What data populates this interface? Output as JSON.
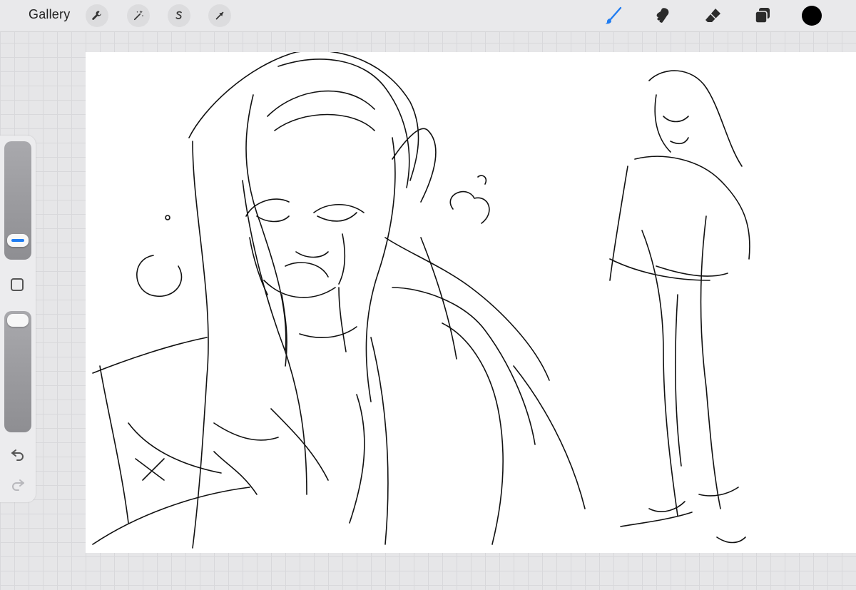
{
  "topbar": {
    "gallery_label": "Gallery",
    "left_tools": [
      {
        "name": "actions",
        "icon": "wrench-icon"
      },
      {
        "name": "adjustments",
        "icon": "magic-wand-icon"
      },
      {
        "name": "selection",
        "icon": "selection-s-icon"
      },
      {
        "name": "transform",
        "icon": "arrow-cursor-icon"
      }
    ],
    "right_tools": [
      {
        "name": "brush",
        "icon": "brush-icon",
        "active": true
      },
      {
        "name": "smudge",
        "icon": "smudge-icon",
        "active": false
      },
      {
        "name": "eraser",
        "icon": "eraser-icon",
        "active": false
      },
      {
        "name": "layers",
        "icon": "layers-icon",
        "active": false
      }
    ],
    "current_color": "#000000",
    "active_color": "#1f7cf2"
  },
  "sidebar": {
    "brush_size_level": 0.1,
    "brush_opacity_level": 1.0
  }
}
